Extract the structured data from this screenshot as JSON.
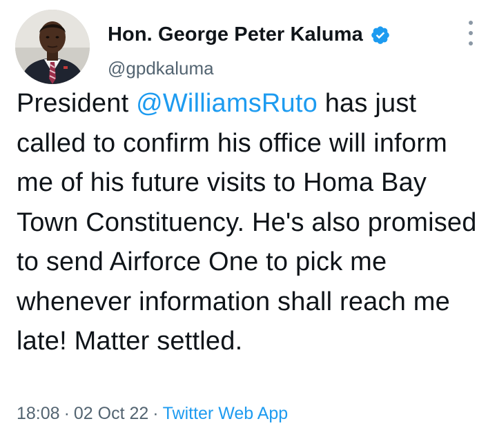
{
  "author": {
    "display_name": "Hon. George Peter Kaluma",
    "handle": "@gpdkaluma",
    "verified_icon": "verified-badge-icon",
    "avatar": "profile-photo"
  },
  "tweet": {
    "text_before": "President ",
    "mention": "@WilliamsRuto",
    "text_after": " has just called to confirm his office will inform me of his future visits to Homa Bay Town Constituency. He's also promised to send Airforce One to pick me whenever information shall reach me late! Matter settled."
  },
  "meta": {
    "time": "18:08",
    "separator": "·",
    "date": "02 Oct 22",
    "source": "Twitter Web App"
  },
  "colors": {
    "accent": "#1d9bf0",
    "secondary_text": "#536471",
    "primary_text": "#0f1419"
  },
  "menu": {
    "icon": "more-options-icon"
  }
}
